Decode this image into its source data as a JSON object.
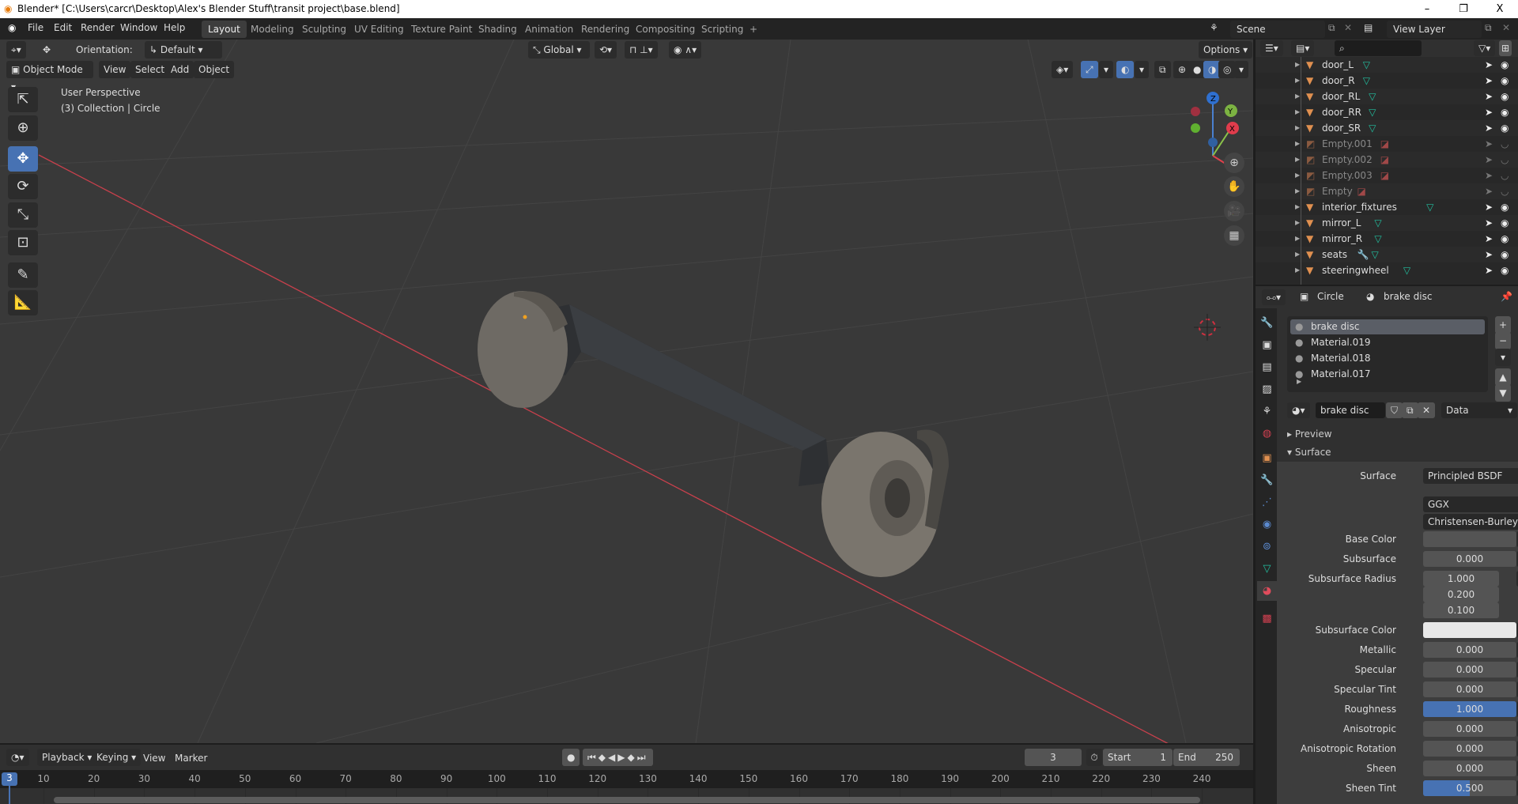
{
  "window": {
    "title": "Blender* [C:\\Users\\carcr\\Desktop\\Alex's Blender Stuff\\transit project\\base.blend]",
    "minimize": "–",
    "maximize": "❐",
    "close": "X"
  },
  "menu": [
    "File",
    "Edit",
    "Render",
    "Window",
    "Help"
  ],
  "workspaces": [
    "Layout",
    "Modeling",
    "Sculpting",
    "UV Editing",
    "Texture Paint",
    "Shading",
    "Animation",
    "Rendering",
    "Compositing",
    "Scripting",
    "+"
  ],
  "scene": "Scene",
  "view_layer": "View Layer",
  "viewport": {
    "orientation_label": "Orientation:",
    "orientation": "Default",
    "transform_orientation": "Global",
    "options": "Options",
    "mode": "Object Mode",
    "menus": [
      "View",
      "Select",
      "Add",
      "Object"
    ],
    "perspective": "User Perspective",
    "collection": "(3) Collection | Circle",
    "axes": {
      "x": "X",
      "y": "Y",
      "z": "Z"
    }
  },
  "outliner": {
    "items": [
      {
        "name": "door_L",
        "type": "mesh"
      },
      {
        "name": "door_R",
        "type": "mesh"
      },
      {
        "name": "door_RL",
        "type": "mesh"
      },
      {
        "name": "door_RR",
        "type": "mesh"
      },
      {
        "name": "door_SR",
        "type": "mesh"
      },
      {
        "name": "Empty.001",
        "type": "empty"
      },
      {
        "name": "Empty.002",
        "type": "empty"
      },
      {
        "name": "Empty.003",
        "type": "empty"
      },
      {
        "name": "Empty",
        "type": "empty"
      },
      {
        "name": "interior_fixtures",
        "type": "mesh"
      },
      {
        "name": "mirror_L",
        "type": "mesh"
      },
      {
        "name": "mirror_R",
        "type": "mesh"
      },
      {
        "name": "seats",
        "type": "mesh",
        "modifier": true
      },
      {
        "name": "steeringwheel",
        "type": "mesh"
      }
    ]
  },
  "properties": {
    "object": "Circle",
    "material": "brake disc",
    "slots": [
      "brake disc",
      "Material.019",
      "Material.018",
      "Material.017"
    ],
    "link": "Data",
    "preview": "Preview",
    "surface_panel": "Surface",
    "surface": {
      "label": "Surface",
      "value": "Principled BSDF"
    },
    "distribution": "GGX",
    "subsurface_method": "Christensen-Burley",
    "fields": [
      {
        "label": "Base Color",
        "kind": "color",
        "color": "#545454"
      },
      {
        "label": "Subsurface",
        "value": "0.000",
        "fraction": 0
      },
      {
        "label": "Subsurface Radius",
        "vector": [
          "1.000",
          "0.200",
          "0.100"
        ]
      },
      {
        "label": "Subsurface Color",
        "kind": "color",
        "color": "#e8e8e8"
      },
      {
        "label": "Metallic",
        "value": "0.000",
        "fraction": 0
      },
      {
        "label": "Specular",
        "value": "0.000",
        "fraction": 0
      },
      {
        "label": "Specular Tint",
        "value": "0.000",
        "fraction": 0
      },
      {
        "label": "Roughness",
        "value": "1.000",
        "fraction": 1
      },
      {
        "label": "Anisotropic",
        "value": "0.000",
        "fraction": 0
      },
      {
        "label": "Anisotropic Rotation",
        "value": "0.000",
        "fraction": 0
      },
      {
        "label": "Sheen",
        "value": "0.000",
        "fraction": 0
      },
      {
        "label": "Sheen Tint",
        "value": "0.500",
        "fraction": 0.5
      }
    ]
  },
  "timeline": {
    "menus": [
      "Playback",
      "Keying",
      "View",
      "Marker"
    ],
    "current_frame": "3",
    "start_label": "Start",
    "start": "1",
    "end_label": "End",
    "end": "250",
    "ticks": [
      "10",
      "20",
      "30",
      "40",
      "50",
      "60",
      "70",
      "80",
      "90",
      "100",
      "110",
      "120",
      "130",
      "140",
      "150",
      "160",
      "170",
      "180",
      "190",
      "200",
      "210",
      "220",
      "230",
      "240"
    ]
  },
  "colors": {
    "accent": "#4772b3",
    "mesh": "#e09050",
    "mesh_data": "#22c0a0",
    "x_axis": "#c8404c"
  }
}
